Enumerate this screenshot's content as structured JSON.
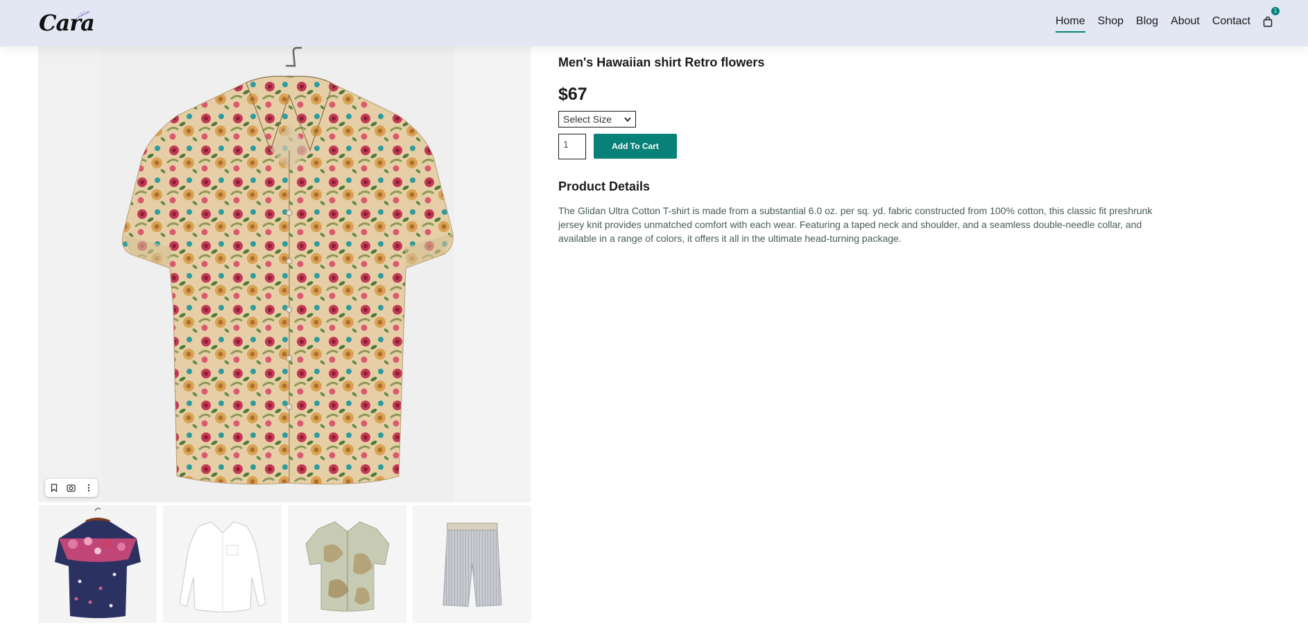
{
  "header": {
    "logo_text": "Cara",
    "nav": [
      "Home",
      "Shop",
      "Blog",
      "About",
      "Contact"
    ],
    "active_nav": "Home",
    "cart_count": "1"
  },
  "gallery": {
    "main_alt": "Floral Hawaiian shirt on hanger",
    "toolbar_icons": [
      "bookmark-icon",
      "lens-icon",
      "more-vertical-icon"
    ],
    "thumbnails": [
      "Navy floral shirt",
      "White linen shirt",
      "Sage printed shirt",
      "Grey striped shorts"
    ]
  },
  "product": {
    "title": "Men's Hawaiian shirt Retro flowers",
    "price": "$67",
    "size_select": "Select Size",
    "quantity": "1",
    "add_to_cart": "Add To Cart",
    "details_heading": "Product Details",
    "details_text": "The Glidan Ultra Cotton T-shirt is made from a substantial 6.0 oz. per sq. yd. fabric constructed from 100% cotton, this classic fit preshrunk jersey knit provides unmatched comfort with each wear. Featuring a taped neck and shoulder, and a seamless double-needle collar, and available in a range of colors, it offers it all in the ultimate head-turning package."
  },
  "colors": {
    "header_bg": "#e3e6f3",
    "accent": "#088178",
    "text": "#1a1a1a",
    "body_text": "#465b52"
  }
}
